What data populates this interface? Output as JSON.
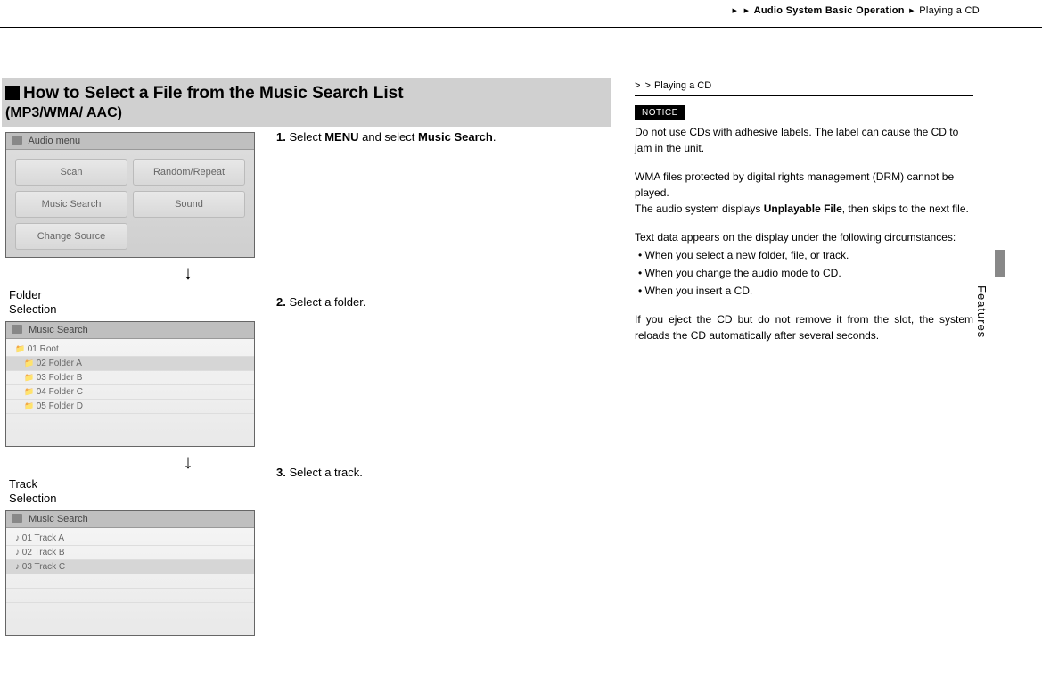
{
  "breadcrumb": {
    "section": "Audio System Basic Operation",
    "page": "Playing a CD"
  },
  "heading": {
    "title": "How to Select a File from the Music Search List",
    "subtitle": "(MP3/WMA/ AAC)"
  },
  "screens": {
    "audioMenu": {
      "title": "Audio menu",
      "buttons": [
        "Scan",
        "Random/Repeat",
        "Music Search",
        "Sound",
        "Change Source"
      ]
    },
    "folderCaption1": "Folder",
    "folderCaption2": "Selection",
    "musicSearch1": {
      "title": "Music Search",
      "rows": [
        "01 Root",
        "02 Folder A",
        "03 Folder B",
        "04 Folder C",
        "05 Folder D"
      ]
    },
    "trackCaption1": "Track",
    "trackCaption2": "Selection",
    "musicSearch2": {
      "title": "Music Search",
      "rows": [
        "01 Track A",
        "02 Track B",
        "03 Track C"
      ]
    }
  },
  "steps": {
    "s1_a": "Select ",
    "s1_b": "MENU",
    "s1_c": " and select ",
    "s1_d": "Music Search",
    "s1_e": ".",
    "s2": "Select a folder.",
    "s3": "Select a track."
  },
  "sidebar": {
    "headRef": "Playing a CD",
    "noticeLabel": "NOTICE",
    "notice": "Do not use CDs with adhesive labels. The label can cause the CD to jam in the unit.",
    "drm1": "WMA files protected by digital rights management (DRM) cannot be played.",
    "drm2a": "The audio system displays ",
    "drm2b": "Unplayable File",
    "drm2c": ", then skips to the next file.",
    "textIntro": "Text data appears on the display under the following circumstances:",
    "bullets": [
      "When you select a new folder, file, or track.",
      "When you change the audio mode to CD.",
      "When you insert a CD."
    ],
    "eject": "If you eject the CD but do not remove it from the slot, the system reloads the CD automatically after several seconds."
  },
  "tab": "Features"
}
